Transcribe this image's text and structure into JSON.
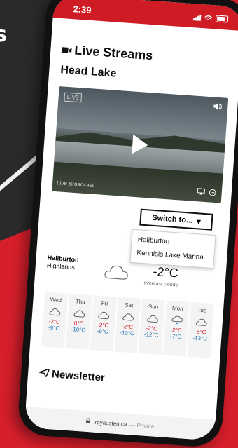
{
  "background": {
    "brand_text": "s",
    "accent": "#d61f2b"
  },
  "status_bar": {
    "time": "2:39"
  },
  "live_streams": {
    "title": "Live Streams",
    "subtitle": "Head Lake",
    "video": {
      "live_badge": "LIVE",
      "broadcast_label": "Live Broadcast"
    }
  },
  "switch_control": {
    "label": "Switch to...",
    "options": [
      "Haliburton",
      "Kennisis Lake Marina"
    ]
  },
  "weather": {
    "location_line1": "Haliburton",
    "location_line2": "Highlands",
    "current_temp": "-2°C",
    "description": "overcast clouds",
    "forecast": [
      {
        "day": "Wed",
        "high": "-2°C",
        "low": "-9°C",
        "icon": "cloud-icon"
      },
      {
        "day": "Thu",
        "high": "0°C",
        "low": "-10°C",
        "icon": "cloud-icon"
      },
      {
        "day": "Fri",
        "high": "-2°C",
        "low": "-9°C",
        "icon": "cloud-icon"
      },
      {
        "day": "Sat",
        "high": "-2°C",
        "low": "-10°C",
        "icon": "cloud-icon"
      },
      {
        "day": "Sun",
        "high": "-2°C",
        "low": "-12°C",
        "icon": "cloud-icon"
      },
      {
        "day": "Mon",
        "high": "-2°C",
        "low": "-7°C",
        "icon": "snow-cloud-icon"
      },
      {
        "day": "Tue",
        "high": "-5°C",
        "low": "-13°C",
        "icon": "cloud-icon"
      }
    ]
  },
  "newsletter": {
    "title": "Newsletter"
  },
  "url_bar": {
    "domain": "troyausten.ca",
    "suffix": "— Private"
  }
}
